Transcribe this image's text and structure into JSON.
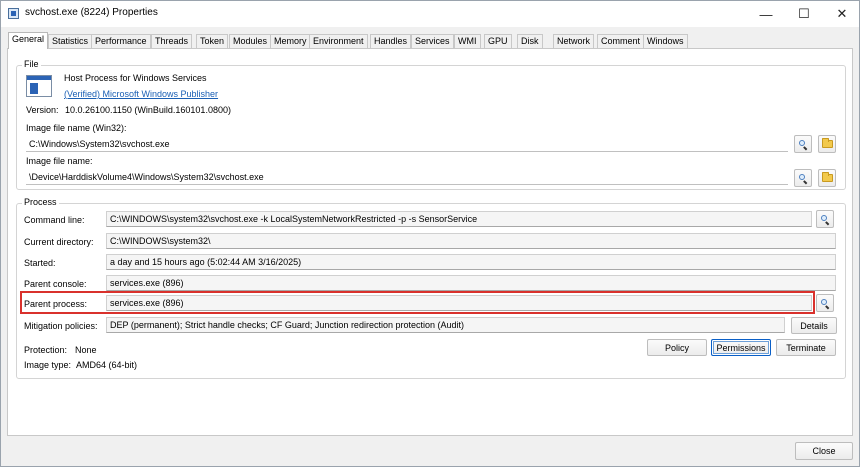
{
  "window": {
    "title": "svchost.exe (8224) Properties",
    "controls": {
      "minimize": "—",
      "maximize": "☐",
      "close": "✕"
    }
  },
  "tabs": [
    "General",
    "Statistics",
    "Performance",
    "Threads",
    "Token",
    "Modules",
    "Memory",
    "Environment",
    "Handles",
    "Services",
    "WMI",
    "GPU",
    "Disk",
    "Network",
    "Comment",
    "Windows"
  ],
  "active_tab": "General",
  "file": {
    "group_label": "File",
    "description": "Host Process for Windows Services",
    "publisher": "(Verified) Microsoft Windows Publisher",
    "version_label": "Version:",
    "version_value": "10.0.26100.1150 (WinBuild.160101.0800)",
    "win32_label": "Image file name (Win32):",
    "win32_value": "C:\\Windows\\System32\\svchost.exe",
    "native_label": "Image file name:",
    "native_value": "\\Device\\HarddiskVolume4\\Windows\\System32\\svchost.exe"
  },
  "process": {
    "group_label": "Process",
    "command_line_label": "Command line:",
    "command_line_value": "C:\\WINDOWS\\system32\\svchost.exe -k LocalSystemNetworkRestricted -p -s SensorService",
    "current_directory_label": "Current directory:",
    "current_directory_value": "C:\\WINDOWS\\system32\\",
    "started_label": "Started:",
    "started_value": "a day and 15 hours ago (5:02:44 AM 3/16/2025)",
    "parent_console_label": "Parent console:",
    "parent_console_value": "services.exe (896)",
    "parent_process_label": "Parent process:",
    "parent_process_value": "services.exe (896)",
    "mitigation_label": "Mitigation policies:",
    "mitigation_value": "DEP (permanent); Strict handle checks; CF Guard; Junction redirection protection (Audit)",
    "details_button": "Details",
    "protection_label": "Protection:",
    "protection_value": "None",
    "image_type_label": "Image type:",
    "image_type_value": "AMD64 (64-bit)",
    "policy_button": "Policy",
    "permissions_button": "Permissions",
    "terminate_button": "Terminate"
  },
  "footer": {
    "close_button": "Close"
  },
  "colors": {
    "highlight": "#d9312c",
    "link": "#1a5fb4"
  }
}
